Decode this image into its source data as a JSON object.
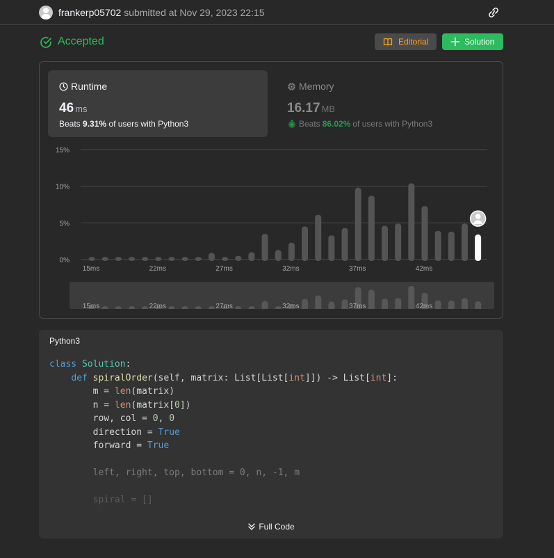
{
  "header": {
    "username": "frankerp05702",
    "submitted_text": "submitted at Nov 29, 2023 22:15"
  },
  "status": {
    "text": "Accepted",
    "color": "#2cbb5d"
  },
  "buttons": {
    "editorial": "Editorial",
    "solution": "Solution"
  },
  "runtime": {
    "title": "Runtime",
    "value": "46",
    "unit": "ms",
    "beats_prefix": "Beats",
    "beats_value": "9.31%",
    "beats_suffix": "of users with Python3"
  },
  "memory": {
    "title": "Memory",
    "value": "16.17",
    "unit": "MB",
    "beats_prefix": "Beats",
    "beats_value": "86.02%",
    "beats_suffix": "of users with Python3"
  },
  "chart_data": {
    "type": "bar",
    "y_ticks": [
      "15%",
      "10%",
      "5%",
      "0%"
    ],
    "ylim": [
      0,
      15
    ],
    "x_ticks": [
      {
        "label": "15ms",
        "index": 0
      },
      {
        "label": "22ms",
        "index": 5
      },
      {
        "label": "27ms",
        "index": 10
      },
      {
        "label": "32ms",
        "index": 15
      },
      {
        "label": "37ms",
        "index": 20
      },
      {
        "label": "42ms",
        "index": 25
      }
    ],
    "values": [
      0.35,
      0.35,
      0.35,
      0.35,
      0.35,
      0.35,
      0.35,
      0.35,
      0.35,
      0.9,
      0.35,
      0.5,
      1.0,
      3.5,
      1.3,
      2.3,
      4.5,
      6.1,
      3.3,
      4.3,
      9.8,
      8.7,
      4.6,
      4.9,
      10.4,
      7.3,
      3.9,
      3.8,
      4.9,
      3.4
    ],
    "highlight_index": 29,
    "bar_color": "#545454",
    "highlight_color": "#ffffff",
    "brush_ticks": [
      "15ms",
      "22ms",
      "27ms",
      "32ms",
      "37ms",
      "42ms"
    ]
  },
  "code": {
    "language": "Python3",
    "full_code_label": "Full Code"
  }
}
